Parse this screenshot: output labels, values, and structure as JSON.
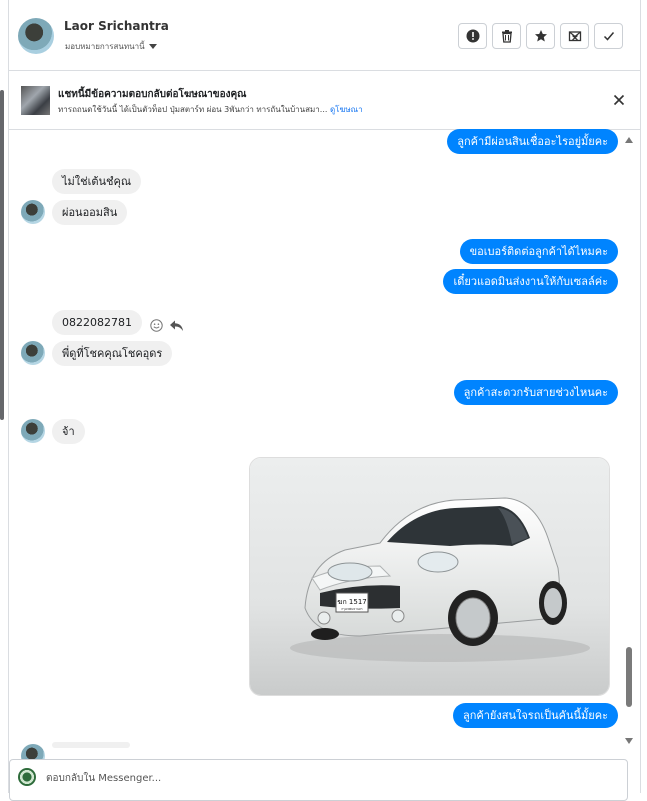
{
  "header": {
    "name": "Laor Srichantra",
    "subtitle": "มอบหมายการสนทนานี้",
    "actions": [
      "report",
      "delete",
      "star",
      "spam",
      "done"
    ]
  },
  "ad": {
    "title": "แชทนี้มีข้อความตอบกลับต่อโฆษณาของคุณ",
    "text": "ทารถถนดใช้วันนี้ ได้เป็นตัวท็อป ปุ่มสตาร์ท ผ่อน 3พันกว่า ทารถันในบ้านสมา...",
    "link": "ดูโฆษณา"
  },
  "messages": {
    "m1": "ลูกค้ามีผ่อนสินเชื่ออะไรอยู่มั้ยคะ",
    "m2": "ไม่ใช่เต้นชํคุณ",
    "m3": "ผ่อนออมสิน",
    "m4": "ขอเบอร์ติดต่อลูกค้าได้ไหมคะ",
    "m5": "เดี๋ยวแอดมินส่งงานให้กับเซลล์ค่ะ",
    "m6": "0822082781",
    "m7": "พี่ดูที่โชคคุณโชคอุดร",
    "m8": "ลูกค้าสะดวกรับสายช่วงไหนคะ",
    "m9": "จ้า",
    "m10": "ลูกค้ายังสนใจรถเป็นคันนี้มั้ยคะ"
  },
  "photo": {
    "plate": "ฆก 1517",
    "plate_sub": "กรุงเทพมหานคร"
  },
  "composer": {
    "placeholder": "ตอบกลับใน Messenger..."
  },
  "colors": {
    "outgoing": "#0084ff",
    "incoming": "#f0f0f0"
  }
}
